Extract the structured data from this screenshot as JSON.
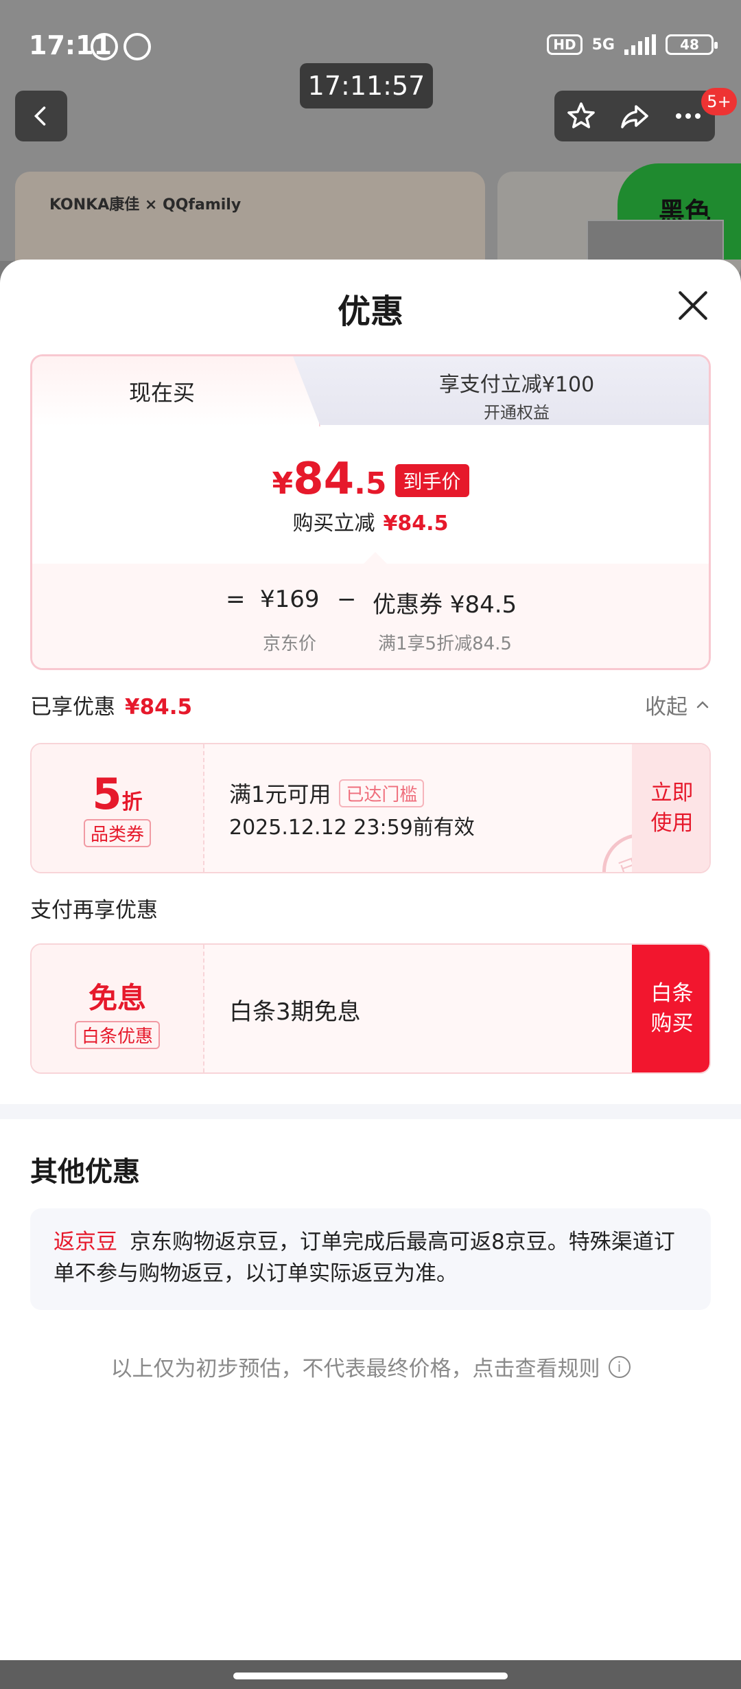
{
  "status": {
    "time": "17:11",
    "hd": "HD",
    "network": "5G",
    "battery": "48"
  },
  "overlay_clock": "17:11:57",
  "nav": {
    "badge": "5+"
  },
  "background": {
    "brand": "KONKA康佳 × QQfamily",
    "green_label": "黑色"
  },
  "sheet": {
    "title": "优惠",
    "tabs": {
      "active": "现在买",
      "other_line1": "享支付立减¥100",
      "other_line2": "开通权益"
    },
    "price": {
      "currency": "¥",
      "integer": "84",
      "decimal": ".5",
      "tag": "到手价",
      "sub_label": "购买立减",
      "sub_value": "¥84.5"
    },
    "calc": {
      "equals": "=",
      "jd_price": "¥169",
      "minus": "−",
      "coupon_label": "优惠券 ¥84.5",
      "jd_price_caption": "京东价",
      "coupon_caption": "满1享5折减84.5"
    },
    "enjoyed": {
      "label": "已享优惠",
      "value": "¥84.5",
      "collapse": "收起"
    },
    "coupon1": {
      "big": "5",
      "unit": "折",
      "type": "品类券",
      "line1": "满1元可用",
      "reached": "已达门槛",
      "line2": "2025.12.12 23:59前有效",
      "stamp": "已领",
      "action": "立即使用"
    },
    "pay_more": "支付再享优惠",
    "coupon2": {
      "big": "免息",
      "type": "白条优惠",
      "line1": "白条3期免息",
      "action": "白条购买"
    },
    "other": {
      "title": "其他优惠",
      "tag": "返京豆",
      "text": "京东购物返京豆，订单完成后最高可返8京豆。特殊渠道订单不参与购物返豆，以订单实际返豆为准。"
    },
    "footer": "以上仅为初步预估，不代表最终价格，点击查看规则"
  },
  "colors": {
    "accent": "#e6192b",
    "overlay": "#7a7a7a"
  }
}
